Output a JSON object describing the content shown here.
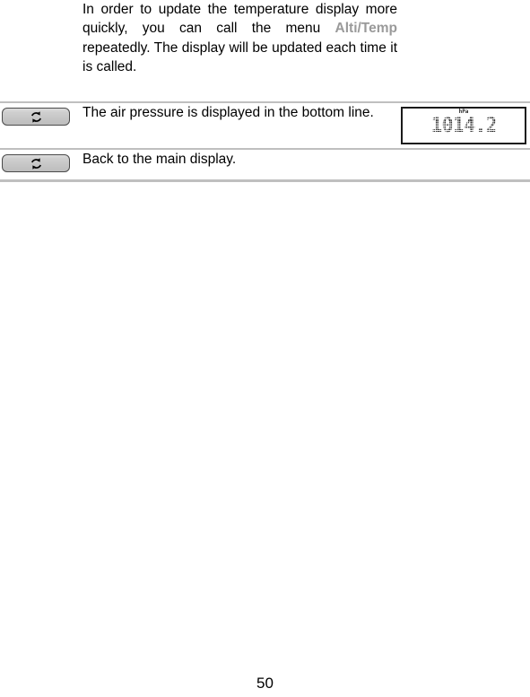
{
  "page": {
    "number": "50"
  },
  "manual_table": {
    "rows": [
      {
        "button": null,
        "button_icon": "cycle-arrows-icon",
        "text_before": "In order to update the temperature display more quickly, you can call the menu ",
        "keyword": "Alti/Temp",
        "text_after": " repeatedly. The display will be updated each time it is called.",
        "display": null
      },
      {
        "button": "cycle-button",
        "button_icon": "cycle-arrows-icon",
        "text_before": "The air pressure is displayed in the bottom line.",
        "keyword": "",
        "text_after": "",
        "display": {
          "unit": "hPa",
          "value": "1014.2"
        }
      },
      {
        "button": "cycle-button",
        "button_icon": "cycle-arrows-icon",
        "text_before": "Back to the main display.",
        "keyword": "",
        "text_after": "",
        "display": null
      }
    ]
  },
  "colors": {
    "keyword_gray": "#9a9a9a",
    "rule_gray": "#bfbfbf",
    "lcd_column_bg": "#e6e6e6",
    "button_face": "#c6c6c6",
    "button_border": "#4a4a4a"
  }
}
